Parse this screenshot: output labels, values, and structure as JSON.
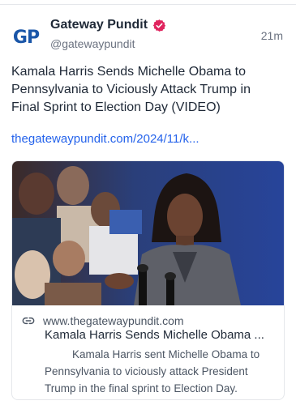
{
  "post": {
    "avatar_text": "GP",
    "display_name": "Gateway Pundit",
    "handle": "@gatewaypundit",
    "timestamp": "21m",
    "text": "Kamala Harris Sends Michelle Obama to Pennsylvania to Viciously Attack Trump in Final Sprint to Election Day (VIDEO)",
    "link": "thegatewaypundit.com/2024/11/k..."
  },
  "card": {
    "domain": "www.thegatewaypundit.com",
    "title": "Kamala Harris Sends Michelle Obama ...",
    "description": "Kamala Harris sent Michelle Obama to Pennsylvania to viciously attack President Trump in the final sprint to Election Day.",
    "image_subject": "woman-at-podium-photo"
  },
  "colors": {
    "verified_badge": "#e0245e",
    "link": "#2563eb",
    "avatar_brand": "#1a56a8"
  }
}
